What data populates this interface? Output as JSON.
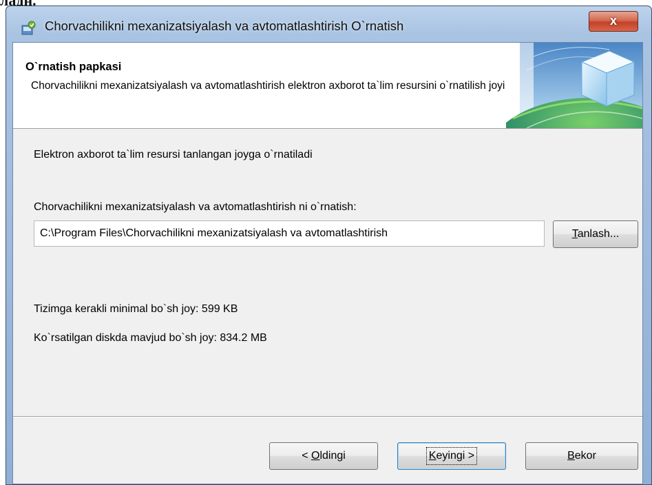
{
  "top_fragment": "ладн.",
  "window": {
    "title": "Chorvachilikni mexanizatsiyalash va avtomatlashtirish O`rnatish",
    "close_label": "x"
  },
  "header": {
    "title": "O`rnatish papkasi",
    "description": "Chorvachilikni mexanizatsiyalash va avtomatlashtirish elektron axborot ta`lim resursini o`rnatilish joyi"
  },
  "main": {
    "intro": "Elektron axborot ta`lim resursi tanlangan joyga o`rnatiladi",
    "path_label": "Chorvachilikni mexanizatsiyalash va avtomatlashtirish ni o`rnatish:",
    "path_value": "C:\\Program Files\\Chorvachilikni mexanizatsiyalash va avtomatlashtirish",
    "browse": {
      "underlined": "T",
      "rest": "anlash..."
    },
    "required_space": "Tizimga kerakli minimal bo`sh joy: 599 KB",
    "available_space": "Ko`rsatilgan diskda mavjud bo`sh joy: 834.2 MB"
  },
  "footer": {
    "back": {
      "prefix": "< ",
      "underlined": "O",
      "rest": "ldingi"
    },
    "next": {
      "underlined": "K",
      "rest": "eyingi >"
    },
    "cancel": {
      "underlined": "B",
      "rest": "ekor"
    }
  },
  "colors": {
    "titlebar": "#a9c3e2",
    "close_button": "#c1422a",
    "client_background": "#f0f0f0",
    "default_button_border": "#3c7fb1"
  },
  "icons": {
    "app": "installer-icon",
    "header_graphic": "globe-cube-graphic"
  }
}
